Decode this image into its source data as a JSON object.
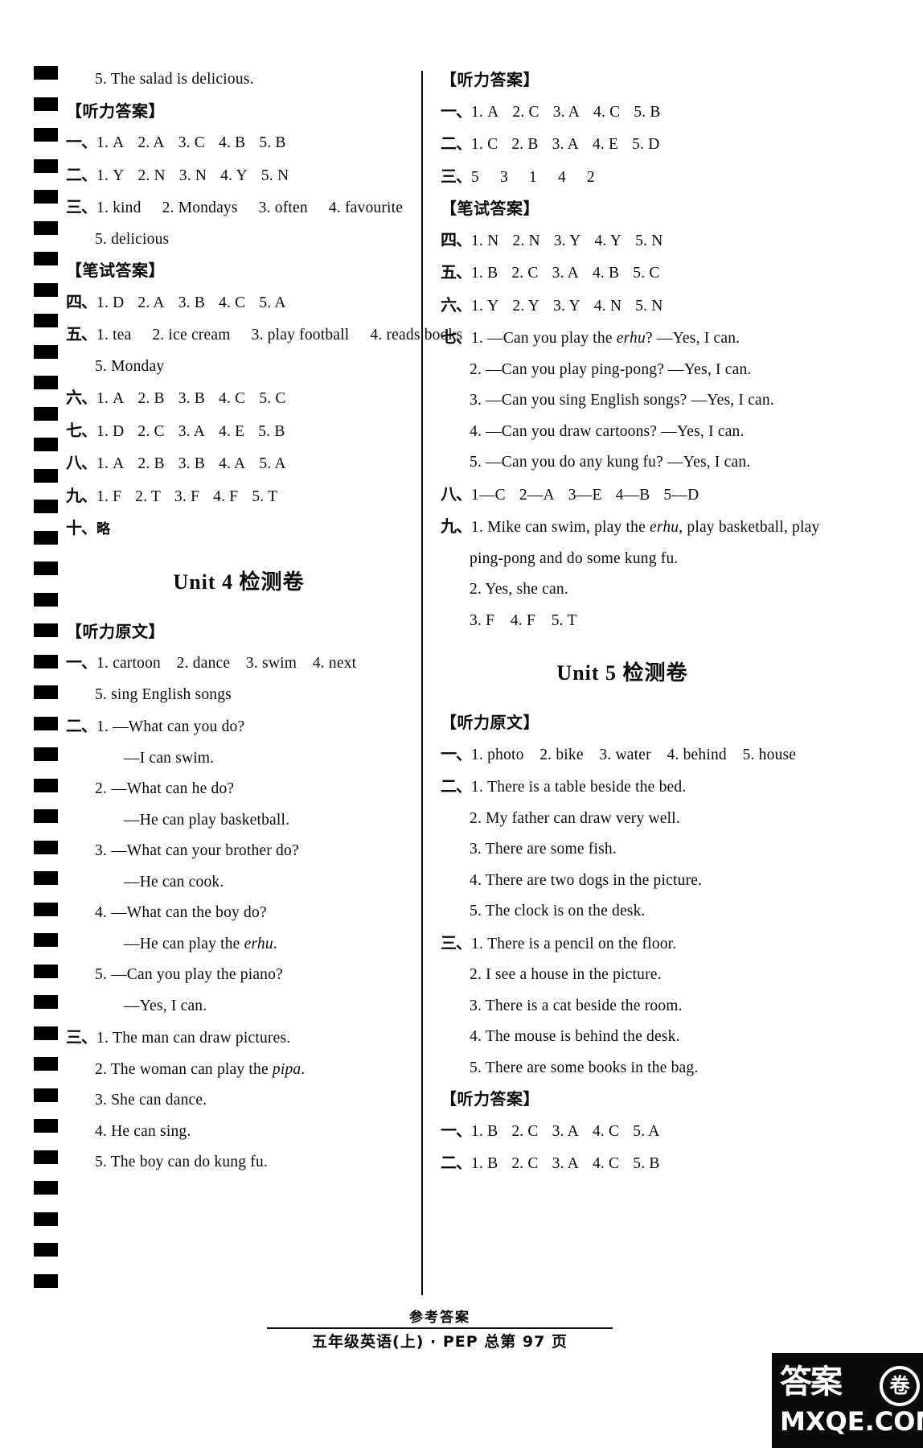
{
  "document": {
    "footer_caption": "参考答案",
    "footer_line": "五年级英语(上) · PEP    总第 97 页",
    "watermark_zh": "答案",
    "watermark_circle": "卷",
    "watermark_url": "MXQE.COM"
  },
  "labels": {
    "listening_answers": "【听力答案】",
    "written_answers": "【笔试答案】",
    "listening_script": "【听力原文】",
    "cn1": "一、",
    "cn2": "二、",
    "cn3": "三、",
    "cn4": "四、",
    "cn5": "五、",
    "cn6": "六、",
    "cn7": "七、",
    "cn8": "八、",
    "cn9": "九、",
    "cn10": "十、",
    "omitted": "略"
  },
  "left_column": {
    "unit3_tail": {
      "script_last_line": "5. The salad is delicious.",
      "listening_answers": [
        {
          "num": "一、",
          "items": [
            "1. A",
            "2. A",
            "3. C",
            "4. B",
            "5. B"
          ]
        },
        {
          "num": "二、",
          "items": [
            "1. Y",
            "2. N",
            "3. N",
            "4. Y",
            "5. N"
          ]
        },
        {
          "num": "三、",
          "items": [
            "1. kind",
            "2. Mondays",
            "3. often",
            "4. favourite"
          ],
          "cont": [
            "5. delicious"
          ]
        }
      ],
      "written_answers": [
        {
          "num": "四、",
          "items": [
            "1. D",
            "2. A",
            "3. B",
            "4. C",
            "5. A"
          ]
        },
        {
          "num": "五、",
          "items": [
            "1. tea",
            "2. ice cream",
            "3. play football",
            "4. reads books"
          ],
          "cont": [
            "5. Monday"
          ]
        },
        {
          "num": "六、",
          "items": [
            "1. A",
            "2. B",
            "3. B",
            "4. C",
            "5. C"
          ]
        },
        {
          "num": "七、",
          "items": [
            "1. D",
            "2. C",
            "3. A",
            "4. E",
            "5. B"
          ]
        },
        {
          "num": "八、",
          "items": [
            "1. A",
            "2. B",
            "3. B",
            "4. A",
            "5. A"
          ]
        },
        {
          "num": "九、",
          "items": [
            "1. F",
            "2. T",
            "3. F",
            "4. F",
            "5. T"
          ]
        },
        {
          "num": "十、",
          "items": [
            "略"
          ]
        }
      ]
    },
    "unit4": {
      "title_latin": "Unit 4",
      "title_zh": "检测卷",
      "script_sections": [
        {
          "num": "一、",
          "first": "1. cartoon　2. dance　3. swim　4. next",
          "cont": [
            "5. sing English songs"
          ]
        },
        {
          "num": "二、",
          "first": "1. —What can you do?",
          "cont": [
            "—I can swim.",
            "2. —What can he do?",
            "—He can play basketball.",
            "3. —What can your brother do?",
            "—He can cook.",
            "4. —What can the boy do?",
            "—He can play the erhu.",
            "5. —Can you play the piano?",
            "—Yes, I can."
          ]
        },
        {
          "num": "三、",
          "first": "1. The man can draw pictures.",
          "cont": [
            "2. The woman can play the pipa.",
            "3. She can dance.",
            "4. He can sing.",
            "5. The boy can do kung fu."
          ]
        }
      ]
    }
  },
  "right_column": {
    "unit4_answers": {
      "listening_answers": [
        {
          "num": "一、",
          "items": [
            "1. A",
            "2. C",
            "3. A",
            "4. C",
            "5. B"
          ]
        },
        {
          "num": "二、",
          "items": [
            "1. C",
            "2. B",
            "3. A",
            "4. E",
            "5. D"
          ]
        },
        {
          "num": "三、",
          "items": [
            "5",
            "3",
            "1",
            "4",
            "2"
          ]
        }
      ],
      "written_answers": [
        {
          "num": "四、",
          "items": [
            "1. N",
            "2. N",
            "3. Y",
            "4. Y",
            "5. N"
          ]
        },
        {
          "num": "五、",
          "items": [
            "1. B",
            "2. C",
            "3. A",
            "4. B",
            "5. C"
          ]
        },
        {
          "num": "六、",
          "items": [
            "1. Y",
            "2. Y",
            "3. Y",
            "4. N",
            "5. N"
          ]
        }
      ],
      "seven": {
        "num": "七、",
        "first": "1. —Can you play the erhu? —Yes, I can.",
        "cont": [
          "2. —Can you play ping-pong? —Yes, I can.",
          "3. —Can you sing English songs? —Yes, I can.",
          "4. —Can you draw cartoons? —Yes, I can.",
          "5. —Can you do any kung fu? —Yes, I can."
        ]
      },
      "eight": {
        "num": "八、",
        "items": [
          "1—C",
          "2—A",
          "3—E",
          "4—B",
          "5—D"
        ]
      },
      "nine": {
        "num": "九、",
        "first": "1. Mike can swim, play the erhu, play basketball, play",
        "cont": [
          "ping-pong and do some kung fu.",
          "2. Yes, she can.",
          "3. F　4. F　5. T"
        ]
      }
    },
    "unit5": {
      "title_latin": "Unit 5",
      "title_zh": "检测卷",
      "script_sections": [
        {
          "num": "一、",
          "first": "1. photo　2. bike　3. water　4. behind　5. house",
          "cont": []
        },
        {
          "num": "二、",
          "first": "1. There is a table beside the bed.",
          "cont": [
            "2. My father can draw very well.",
            "3. There are some fish.",
            "4. There are two dogs in the picture.",
            "5. The clock is on the desk."
          ]
        },
        {
          "num": "三、",
          "first": "1. There is a pencil on the floor.",
          "cont": [
            "2. I see a house in the picture.",
            "3. There is a cat beside the room.",
            "4. The mouse is behind the desk.",
            "5. There are some books in the bag."
          ]
        }
      ],
      "listening_answers": [
        {
          "num": "一、",
          "items": [
            "1. B",
            "2. C",
            "3. A",
            "4. C",
            "5. A"
          ]
        },
        {
          "num": "二、",
          "items": [
            "1. B",
            "2. C",
            "3. A",
            "4. C",
            "5. B"
          ]
        }
      ]
    }
  }
}
